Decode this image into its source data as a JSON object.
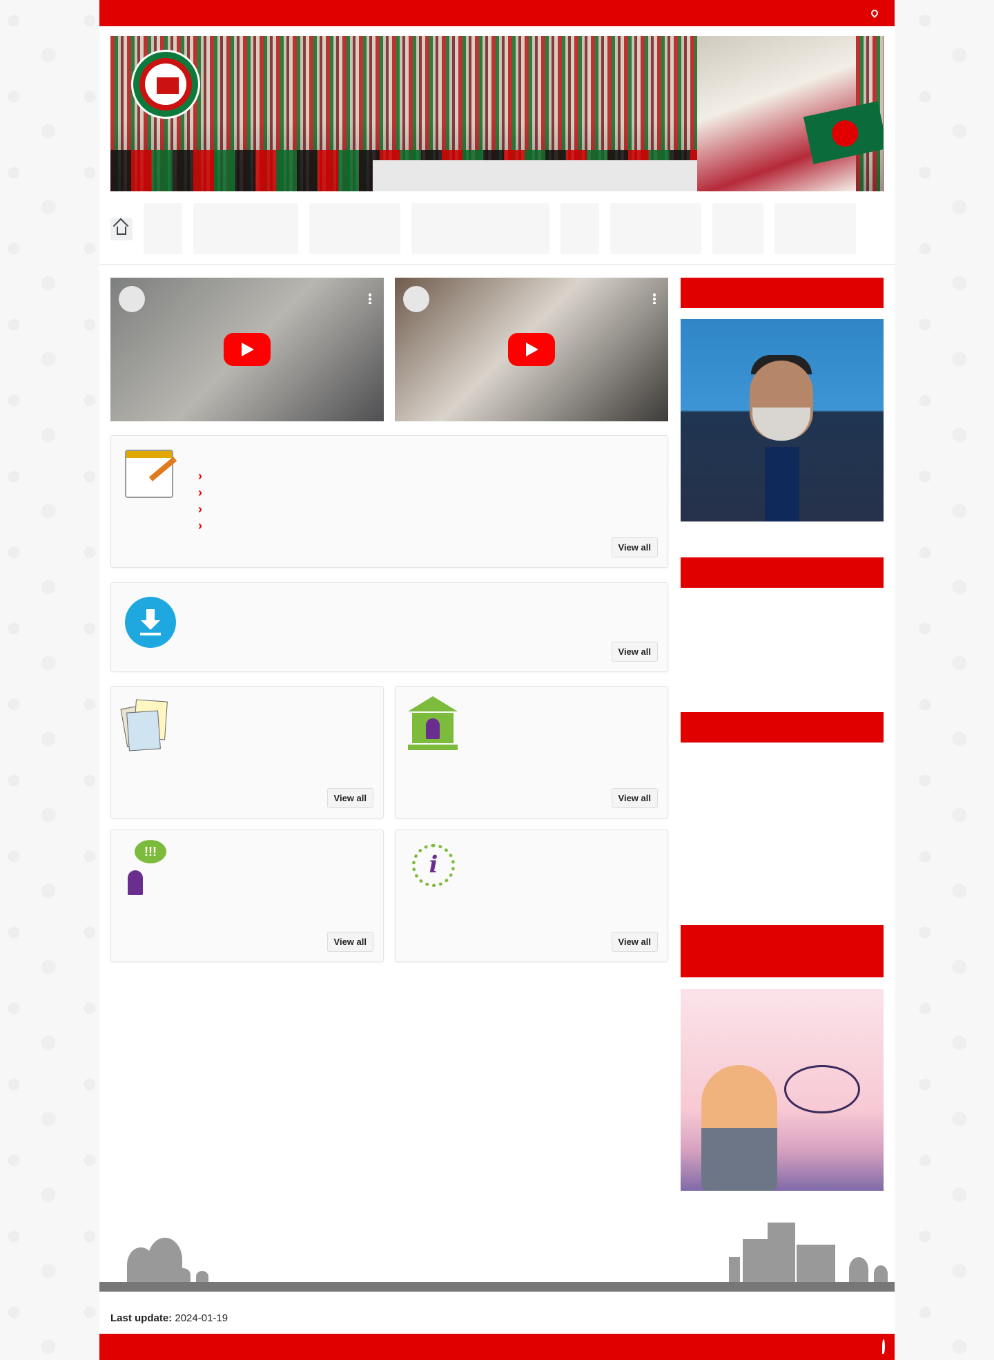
{
  "header": {
    "location_text": "",
    "site_title": "",
    "banner_alt": ""
  },
  "nav": {
    "home_label": "",
    "items": [
      {
        "label": ""
      },
      {
        "label": ""
      },
      {
        "label": ""
      },
      {
        "label": ""
      },
      {
        "label": ""
      },
      {
        "label": ""
      },
      {
        "label": ""
      },
      {
        "label": ""
      }
    ]
  },
  "videos": [
    {
      "title": "",
      "caption": ""
    },
    {
      "title": "",
      "caption": ""
    }
  ],
  "notice_board": {
    "title": "",
    "items": [
      "",
      "",
      "",
      ""
    ],
    "view_all": "View all"
  },
  "downloads": {
    "title": "",
    "view_all": "View all"
  },
  "boxes": [
    {
      "title": "",
      "view_all": "View all",
      "icon": "documents-icon"
    },
    {
      "title": "",
      "view_all": "View all",
      "icon": "government-office-icon"
    },
    {
      "title": "",
      "view_all": "View all",
      "icon": "complaint-icon"
    },
    {
      "title": "",
      "view_all": "View all",
      "icon": "information-icon"
    }
  ],
  "sidebar": {
    "officer_heading": "",
    "officer_name": "",
    "eservices_heading": "",
    "eservice_links": [
      {
        "text": "",
        "style": "red"
      },
      {
        "text": "",
        "style": "small"
      },
      {
        "text": "",
        "style": "bold"
      },
      {
        "text": "",
        "style": "red"
      }
    ],
    "important_links_heading": "",
    "important_links": [
      {
        "text": "",
        "style": "bold"
      },
      {
        "text": "",
        "style": "small"
      },
      {
        "text": "",
        "style": "small"
      },
      {
        "text": "",
        "style": "small"
      },
      {
        "text": "",
        "style": "bold"
      }
    ],
    "awareness_heading": "",
    "poster_text": ""
  },
  "footer": {
    "last_update_label": "Last update:",
    "last_update_date": "2024-01-19",
    "location_text": ""
  },
  "colors": {
    "accent_red": "#e00000",
    "green": "#7cbb3b",
    "purple": "#6a2f8e",
    "download_blue": "#1fa7e0"
  }
}
